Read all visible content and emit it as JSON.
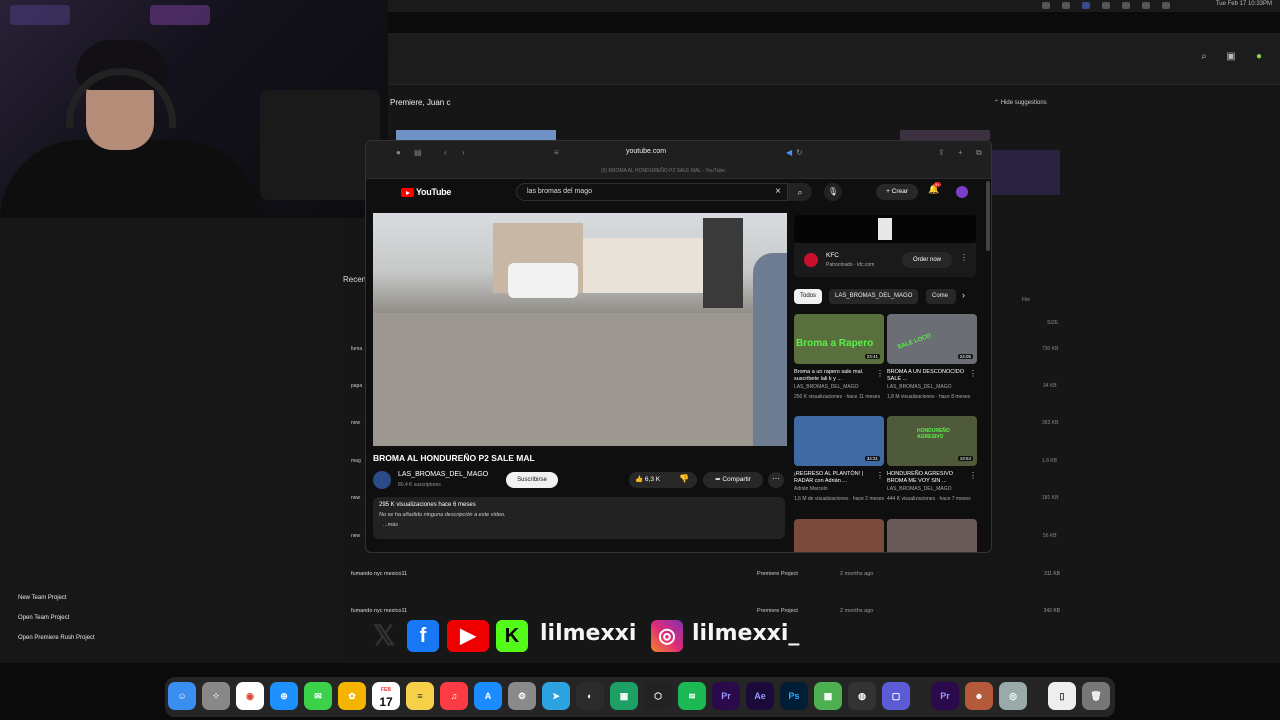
{
  "menubar": {
    "clock": "Tue Feb 17 10:33PM"
  },
  "premiere": {
    "greeting": "Premiere, Juan c",
    "hide_suggestions": "Hide suggestions",
    "recent_label": "Recen",
    "columns": {
      "size": "SIZE",
      "file": "File"
    },
    "sidebar": {
      "new_team_project": "New Team Project",
      "open_team_project": "Open Team Project",
      "open_rush_project": "Open Premiere Rush Project"
    },
    "partial_rows": [
      "fuma",
      "papa",
      "new",
      "mag",
      "new",
      "new"
    ],
    "rows": [
      {
        "name": "",
        "type": "",
        "date": "",
        "size": "730 KB"
      },
      {
        "name": "",
        "type": "",
        "date": "",
        "size": "34 KB"
      },
      {
        "name": "",
        "type": "",
        "date": "",
        "size": "363 KB"
      },
      {
        "name": "",
        "type": "",
        "date": "",
        "size": "1.8 KB"
      },
      {
        "name": "",
        "type": "",
        "date": "",
        "size": "181 KB"
      },
      {
        "name": "",
        "type": "",
        "date": "",
        "size": "56 KB"
      },
      {
        "name": "fumando nyc mexico11",
        "type": "Premiere Project",
        "date": "2 months ago",
        "size": "311 KB"
      },
      {
        "name": "fumando nyc mexico11",
        "type": "Premiere Project",
        "date": "2 months ago",
        "size": "342 KB"
      }
    ]
  },
  "safari": {
    "url": "youtube.com",
    "tab_title": "(6) BROMA AL HONDUREÑO P2 SALE MAL - YouTube"
  },
  "youtube": {
    "logo": "YouTube",
    "search_value": "las bromas del mago",
    "create_label": "Crear",
    "notif_count": "9+",
    "video": {
      "title": "BROMA AL HONDUREÑO P2 SALE MAL",
      "channel": "LAS_BROMAS_DEL_MAGO",
      "subscribers": "80,4 K suscriptores",
      "subscribe_label": "Suscribirse",
      "likes": "6,3 K",
      "share_label": "Compartir",
      "stats": "295 K visualizaciones  hace 6 meses",
      "description": "No se ha añadido ninguna descripción a este vídeo.",
      "more": "...más"
    },
    "ad": {
      "name": "KFC",
      "sponsored": "Patrocinado · kfc.com",
      "cta": "Order now"
    },
    "chips": [
      "Todos",
      "LAS_BROMAS_DEL_MAGO",
      "Come"
    ],
    "recommendations": [
      {
        "title": "Broma a un rapero sale mal. suscribete lali k y ...",
        "channel": "LAS_BROMAS_DEL_MAGO",
        "views": "250 K visualizaciones · hace 11 meses",
        "duration": "23:41",
        "thumb_text": "Broma a Rapero",
        "color": "#5a6f3e"
      },
      {
        "title": "BROMA A UN DESCONOCIDO SALE ...",
        "channel": "LAS_BROMAS_DEL_MAGO",
        "views": "1,8 M visualizaciones · hace 8 meses",
        "duration": "24:05",
        "thumb_text": "SALE LOCO",
        "color": "#6b6e74"
      },
      {
        "title": "¡REGRESO AL PLANTÓN! | RADAR con Adrián ...",
        "channel": "Adrián Marcelo",
        "views": "1,6 M de visualizaciones · hace 2 meses",
        "duration": "34:31",
        "thumb_text": "",
        "color": "#3f6aa4"
      },
      {
        "title": "HONDUREÑO AGRESIVO BROMA ME VOY SIN ...",
        "channel": "LAS_BROMAS_DEL_MAGO",
        "views": "444 K visualizaciones · hace 7 meses",
        "duration": "19:54",
        "thumb_text": "HONDUREÑO AGRESIVO",
        "color": "#4e5a3a"
      },
      {
        "title": "",
        "channel": "",
        "views": "",
        "duration": "",
        "thumb_text": "",
        "color": "#7a4a3a"
      },
      {
        "title": "",
        "channel": "",
        "views": "",
        "duration": "",
        "thumb_text": "",
        "color": "#6a5a5a"
      }
    ]
  },
  "overlay": {
    "handle_1": "lilmexxi",
    "handle_2": "lilmexxi_"
  },
  "dock": {
    "calendar_month": "FEB",
    "calendar_day": "17",
    "apps": [
      "Finder",
      "Launchpad",
      "Chrome",
      "Safari",
      "Messages",
      "Photos",
      "Calendar",
      "Notes",
      "Music",
      "App Store",
      "System Settings",
      "Telegram",
      "OBS",
      "Discord",
      "Unity",
      "Spotify",
      "Premiere",
      "After Effects",
      "Photoshop",
      "Minecraft",
      "Steam",
      "Remote",
      "Premiere",
      "Roblox",
      "Finder2",
      "Files",
      "Trash"
    ]
  }
}
